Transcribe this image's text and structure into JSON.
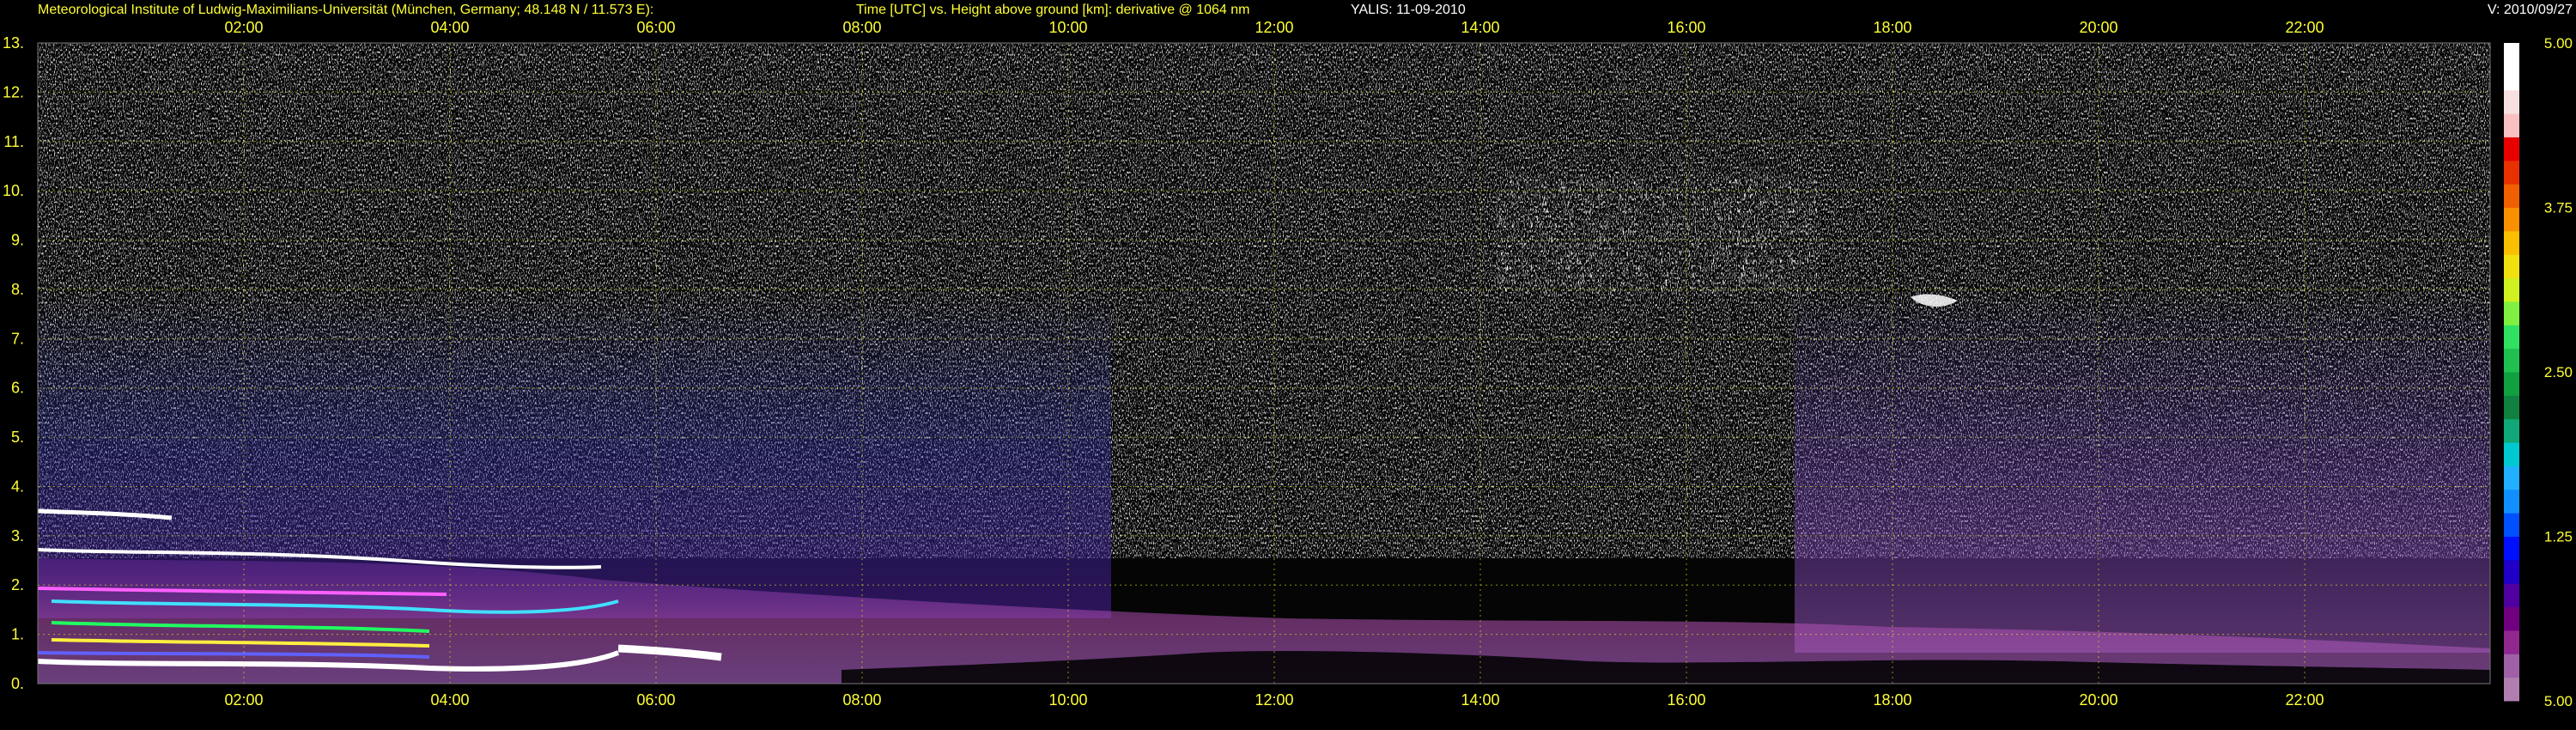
{
  "header": {
    "institute": "Meteorological Institute of Ludwig-Maximilians-Universität (München, Germany; 48.148 N / 11.573 E):",
    "description": "Time [UTC] vs. Height above ground [km]: derivative @ 1064 nm",
    "instrument_date": "YALIS: 11-09-2010",
    "version": "V: 2010/09/27"
  },
  "colors": {
    "background": "#000000",
    "text": "#ffff33",
    "grid": "#ffff00",
    "noise": "#c8c8c8"
  },
  "chart_data": {
    "type": "heatmap",
    "xlabel": "",
    "ylabel": "",
    "x_unit": "hour UTC",
    "xlim": [
      0.0,
      23.8
    ],
    "ylim": [
      0,
      13
    ],
    "x_ticks": [
      {
        "value": 2,
        "label": "02:00"
      },
      {
        "value": 4,
        "label": "04:00"
      },
      {
        "value": 6,
        "label": "06:00"
      },
      {
        "value": 8,
        "label": "08:00"
      },
      {
        "value": 10,
        "label": "10:00"
      },
      {
        "value": 12,
        "label": "12:00"
      },
      {
        "value": 14,
        "label": "14:00"
      },
      {
        "value": 16,
        "label": "16:00"
      },
      {
        "value": 18,
        "label": "18:00"
      },
      {
        "value": 20,
        "label": "20:00"
      },
      {
        "value": 22,
        "label": "22:00"
      }
    ],
    "y_ticks": [
      {
        "value": 0,
        "label": "0."
      },
      {
        "value": 1,
        "label": "1."
      },
      {
        "value": 2,
        "label": "2."
      },
      {
        "value": 3,
        "label": "3."
      },
      {
        "value": 4,
        "label": "4."
      },
      {
        "value": 5,
        "label": "5."
      },
      {
        "value": 6,
        "label": "6."
      },
      {
        "value": 7,
        "label": "7."
      },
      {
        "value": 8,
        "label": "8."
      },
      {
        "value": 9,
        "label": "9."
      },
      {
        "value": 10,
        "label": "10."
      },
      {
        "value": 11,
        "label": "11."
      },
      {
        "value": 12,
        "label": "12."
      },
      {
        "value": 13,
        "label": "13."
      }
    ],
    "grid": true,
    "colorbar": {
      "position": "right",
      "ticks": [
        {
          "value": 5.0,
          "label": "5.00"
        },
        {
          "value": 3.75,
          "label": "3.75"
        },
        {
          "value": 2.5,
          "label": "2.50"
        },
        {
          "value": 1.25,
          "label": "1.25"
        },
        {
          "value": 0.0,
          "label": "5.00"
        }
      ],
      "colors": [
        "#b07fb0",
        "#a060a8",
        "#902890",
        "#700080",
        "#5000a0",
        "#2000c8",
        "#0010ff",
        "#0050ff",
        "#1090ff",
        "#20b0ff",
        "#00c8d0",
        "#10a878",
        "#108040",
        "#10a040",
        "#20c050",
        "#30e060",
        "#80f040",
        "#d0f020",
        "#f0e010",
        "#f8c000",
        "#f89000",
        "#f06000",
        "#e83000",
        "#e80000",
        "#f8c0c0",
        "#f8e0e0",
        "#ffffff",
        "#ffffff"
      ]
    },
    "features": [
      {
        "name": "upper-cloud",
        "x_range": [
          13.9,
          17.7
        ],
        "y_range": [
          7.8,
          10.4
        ]
      },
      {
        "name": "small-cloud",
        "x_range": [
          18.3,
          18.7
        ],
        "y_range": [
          7.9,
          8.1
        ]
      },
      {
        "name": "residual-layer-top",
        "x_range": [
          0.0,
          1.4
        ],
        "y_range": [
          3.6,
          3.9
        ]
      },
      {
        "name": "boundary-layer",
        "x_range": [
          0.0,
          23.8
        ],
        "y_range": [
          0.2,
          3.0
        ]
      }
    ]
  }
}
